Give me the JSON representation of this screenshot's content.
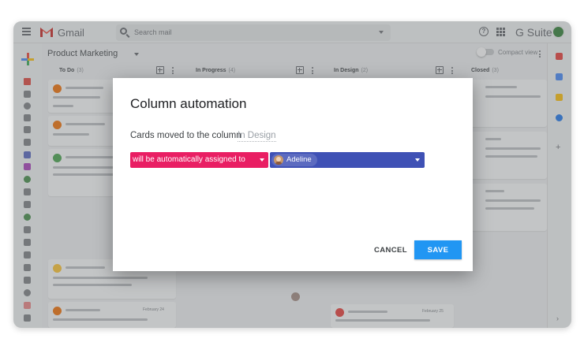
{
  "topbar": {
    "brand": "Gmail",
    "search_placeholder": "Search mail",
    "suite": "G Suite"
  },
  "board": {
    "title": "Product Marketing",
    "compact_view": "Compact view",
    "columns": [
      {
        "name": "To Do",
        "count": "(3)"
      },
      {
        "name": "In Progress",
        "count": "(4)"
      },
      {
        "name": "In Design",
        "count": "(2)"
      },
      {
        "name": "Closed",
        "count": "(3)"
      }
    ],
    "card_dates": [
      "February 24",
      "February 25"
    ]
  },
  "dialog": {
    "title": "Column automation",
    "description": "Cards moved to the column",
    "column_name": "In Design",
    "rule": "will be automatically assigned to",
    "assignee": "Adeline",
    "cancel_label": "CANCEL",
    "save_label": "SAVE"
  },
  "colors": {
    "rule_select": "#e91e63",
    "assignee_select": "#3f51b5",
    "save_button": "#2196f3"
  }
}
